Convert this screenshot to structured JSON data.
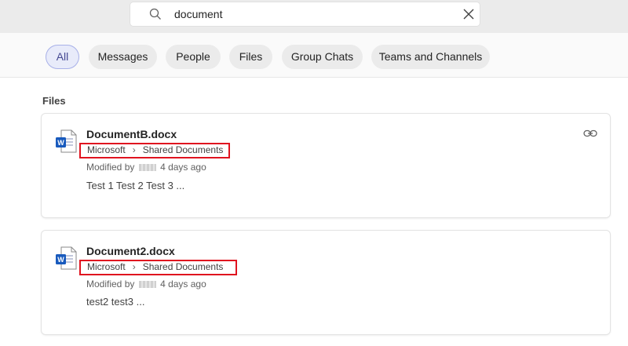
{
  "search": {
    "query": "document"
  },
  "filters": [
    {
      "label": "All",
      "active": true
    },
    {
      "label": "Messages",
      "active": false
    },
    {
      "label": "People",
      "active": false
    },
    {
      "label": "Files",
      "active": false
    },
    {
      "label": "Group Chats",
      "active": false
    },
    {
      "label": "Teams and Channels",
      "active": false
    }
  ],
  "files_section": {
    "title": "Files",
    "results": [
      {
        "name": "DocumentB.docx",
        "path": [
          "Microsoft",
          "Shared Documents"
        ],
        "modified_prefix": "Modified by",
        "modified_when": "4 days ago",
        "snippet": "Test 1 Test 2 Test 3 ..."
      },
      {
        "name": "Document2.docx",
        "path": [
          "Microsoft",
          "Shared Documents"
        ],
        "modified_prefix": "Modified by",
        "modified_when": "4 days ago",
        "snippet": "test2 test3 ..."
      }
    ]
  },
  "colors": {
    "highlight_box": "#e0131f",
    "word_blue": "#185abd",
    "active_pill": "#444791"
  },
  "icons": {
    "search": "search-icon",
    "clear": "close-icon",
    "file": "word-document-icon",
    "link": "link-icon"
  }
}
